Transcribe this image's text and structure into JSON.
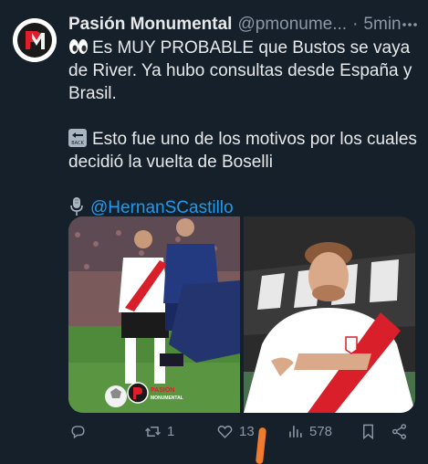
{
  "author": {
    "name": "Pasión Monumental",
    "handle": "@pmonume...",
    "separator": "·",
    "time": "5min",
    "avatar_icon": "pasion-monumental-logo"
  },
  "tweet": {
    "line1": "Es MUY PROBABLE que Bustos se vaya de River. Ya hubo consultas desde España y Brasil.",
    "line2": "Esto fue uno de los motivos por los cuales decidió la vuelta de Boselli",
    "mention": "@HernanSCastillo"
  },
  "media": {
    "photos": [
      {
        "description": "river-player-vs-opponent"
      },
      {
        "description": "river-player-portrait"
      }
    ],
    "watermark": "PASIÓN MONUMENTAL"
  },
  "actions": {
    "replies": "",
    "retweets": "1",
    "likes": "13",
    "views": "578"
  },
  "colors": {
    "background": "#15202b",
    "text": "#e7e9ea",
    "muted": "#8b98a5",
    "link": "#1d9bf0",
    "river_red": "#d81f2a"
  }
}
